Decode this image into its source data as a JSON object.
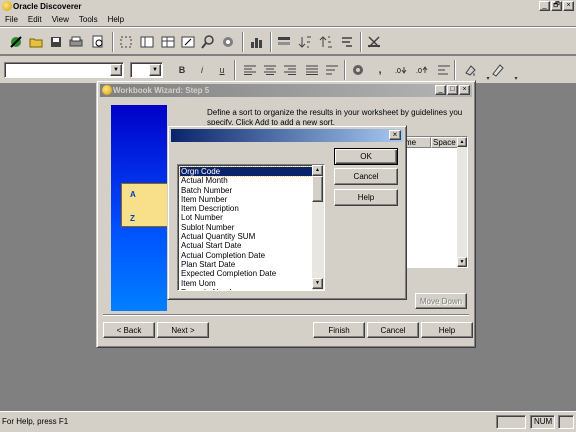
{
  "app": {
    "title": "Oracle Discoverer",
    "window_buttons": [
      "_",
      "🗗",
      "×"
    ]
  },
  "menu": [
    "File",
    "Edit",
    "View",
    "Tools",
    "Help"
  ],
  "toolbar2": {
    "bold": "B",
    "italic": "i",
    "underline": "u",
    "comma": ","
  },
  "wizard": {
    "title": "Workbook Wizard: Step 5",
    "description": "Define a sort to organize the results in your worksheet by guidelines you specify. Click Add to add a new sort.",
    "grid_headers": [
      "me",
      "Space"
    ],
    "image_letters": [
      "A",
      "Z"
    ],
    "hidden_buttons": [
      "Move Down"
    ],
    "nav": {
      "back": "< Back",
      "next": "Next >",
      "finish": "Finish",
      "cancel": "Cancel",
      "help": "Help"
    }
  },
  "sort_dialog": {
    "title": "",
    "close": "×",
    "buttons": {
      "ok": "OK",
      "cancel": "Cancel",
      "help": "Help"
    },
    "fields": [
      "Orgn Code",
      "Actual Month",
      "Batch Number",
      "Item Number",
      "Item Description",
      "Lot Number",
      "Sublot Number",
      "Actual Quantity SUM",
      "Actual Start Date",
      "Actual Completion Date",
      "Plan Start Date",
      "Expected Completion Date",
      "Item Uom",
      "Formula Number"
    ],
    "selected_index": 0
  },
  "status": {
    "message": "For Help, press F1",
    "num": "NUM"
  }
}
